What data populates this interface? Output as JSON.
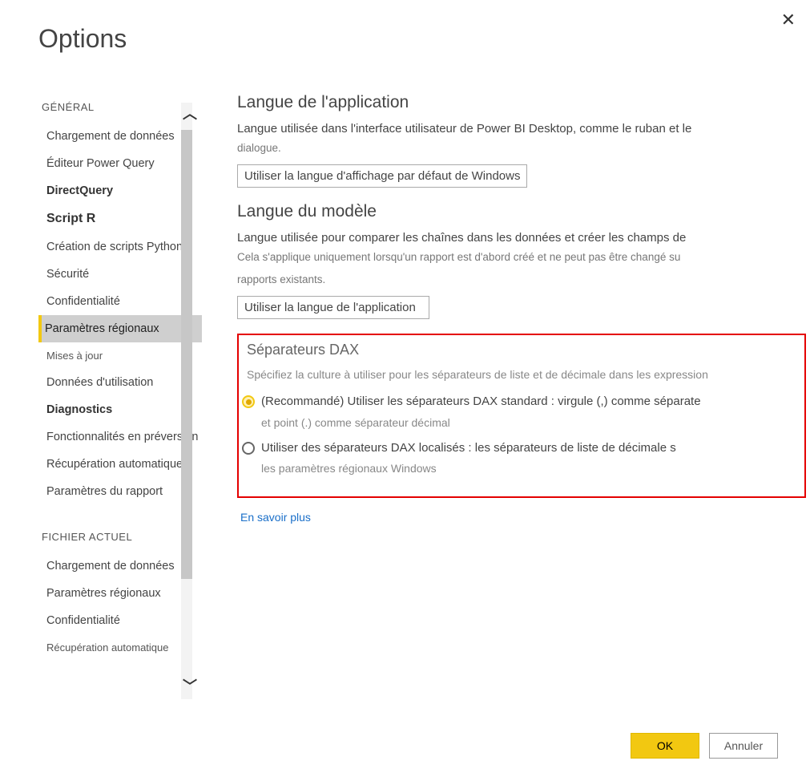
{
  "title": "Options",
  "sidebar": {
    "section1_header": "GÉNÉRAL",
    "items1": [
      "Chargement de données",
      "Éditeur Power Query",
      "DirectQuery",
      "Script R",
      "Création de scripts Python",
      "Sécurité",
      "Confidentialité",
      "Paramètres régionaux",
      "Mises à jour",
      "Données d'utilisation",
      "Diagnostics",
      "Fonctionnalités en préversion",
      "Récupération automatique",
      "Paramètres du rapport"
    ],
    "section2_header": "FICHIER ACTUEL",
    "items2": [
      "Chargement de données",
      "Paramètres régionaux",
      "Confidentialité",
      "Récupération automatique"
    ]
  },
  "content": {
    "app_lang_title": "Langue de l'application",
    "app_lang_desc": "Langue utilisée dans l'interface utilisateur de Power BI Desktop, comme le ruban et le",
    "app_lang_desc2": "dialogue.",
    "app_lang_select": "Utiliser la langue d'affichage par défaut de Windows",
    "model_lang_title": "Langue du modèle",
    "model_lang_desc": "Langue utilisée pour comparer les chaînes dans les données et créer les champs de",
    "model_lang_sub": "Cela s'applique uniquement lorsqu'un rapport est d'abord créé et ne peut pas être changé su",
    "model_lang_sub2": "rapports existants.",
    "model_lang_select": "Utiliser la langue de l'application",
    "dax_title": "Séparateurs DAX",
    "dax_desc": "Spécifiez la culture à utiliser pour les séparateurs de liste et de décimale dans les expression",
    "radio1_label": "(Recommandé) Utiliser les séparateurs DAX standard : virgule (,) comme séparate",
    "radio1_sub": "et point (.) comme séparateur décimal",
    "radio2_label": "Utiliser des séparateurs DAX localisés : les séparateurs de liste de décimale s",
    "radio2_sub": "les paramètres régionaux Windows",
    "learn_more": "En savoir plus"
  },
  "footer": {
    "ok": "OK",
    "cancel": "Annuler"
  }
}
